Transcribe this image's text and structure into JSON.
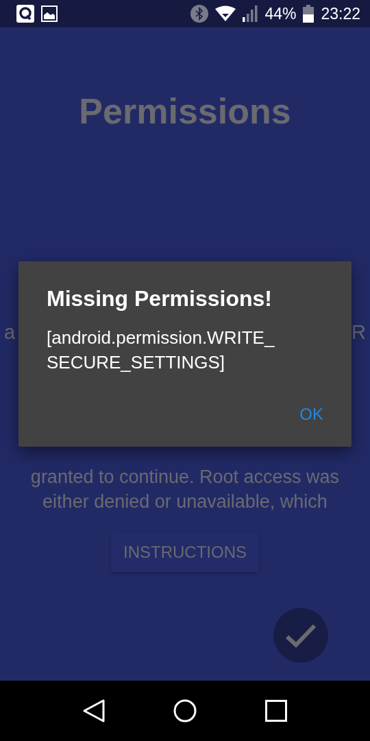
{
  "status_bar": {
    "battery": "44%",
    "time": "23:22"
  },
  "page": {
    "title": "Permissions",
    "covered_line_fragments": [
      "a",
      "R"
    ],
    "message_lines": [
      "granted to continue. Root access was",
      "either denied or unavailable, which"
    ],
    "button": "INSTRUCTIONS"
  },
  "dialog": {
    "title": "Missing Permissions!",
    "message": "[android.permission.WRITE_ SECURE_SETTINGS]",
    "buttons": [
      "OK"
    ]
  }
}
